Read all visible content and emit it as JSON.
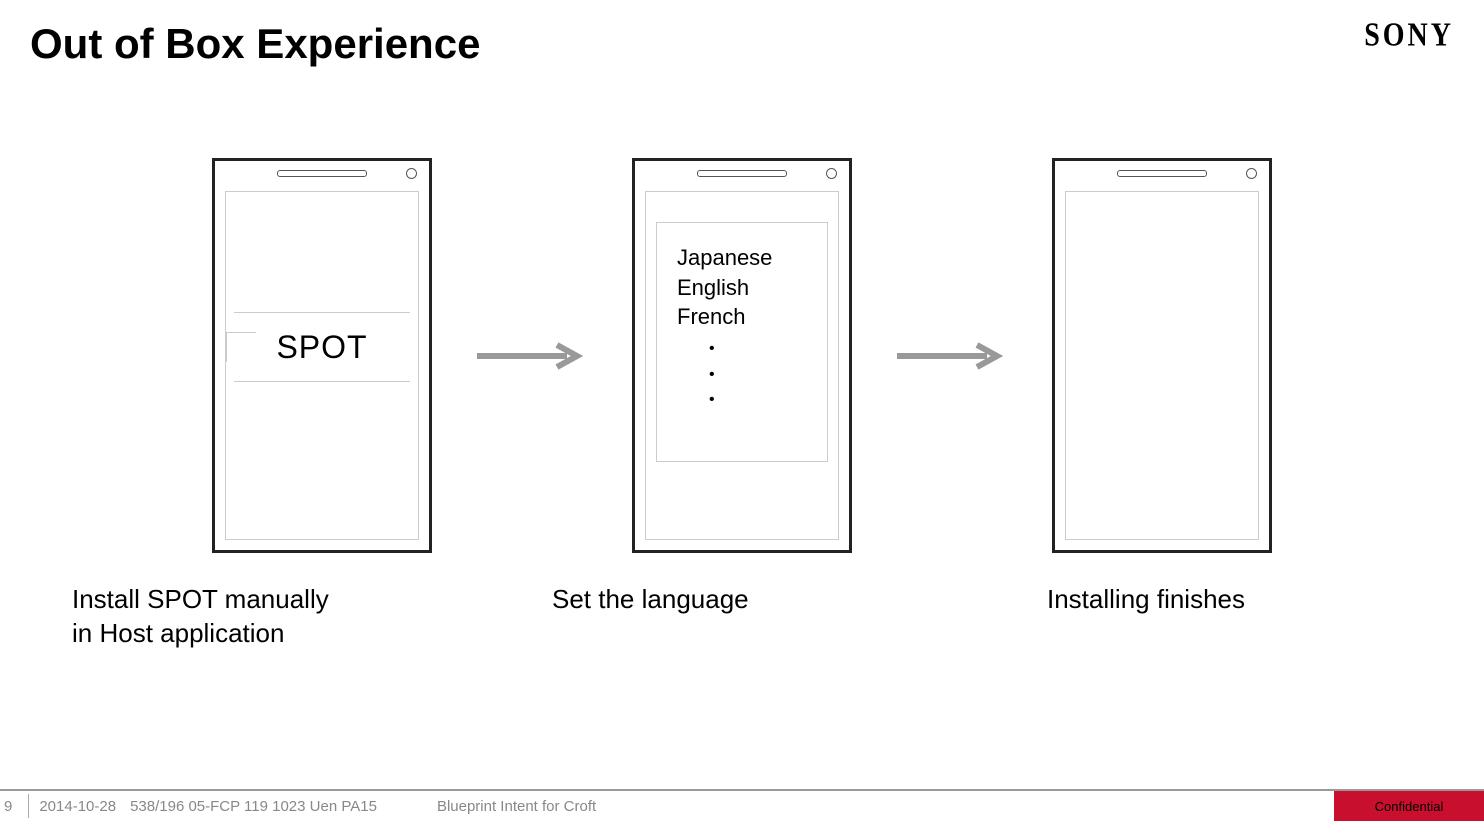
{
  "header": {
    "title": "Out of Box Experience",
    "logo": "SONY"
  },
  "steps": {
    "spot_label": "SPOT",
    "languages": [
      "Japanese",
      "English",
      "French"
    ],
    "cap1": "Install SPOT manually in Host application",
    "cap2": "Set the language",
    "cap3": "Installing finishes"
  },
  "footer": {
    "page": "9",
    "date": "2014-10-28",
    "docid": "538/196 05-FCP 119 1023 Uen PA15",
    "blueprint": "Blueprint Intent for Croft",
    "confidential": "Confidential"
  }
}
